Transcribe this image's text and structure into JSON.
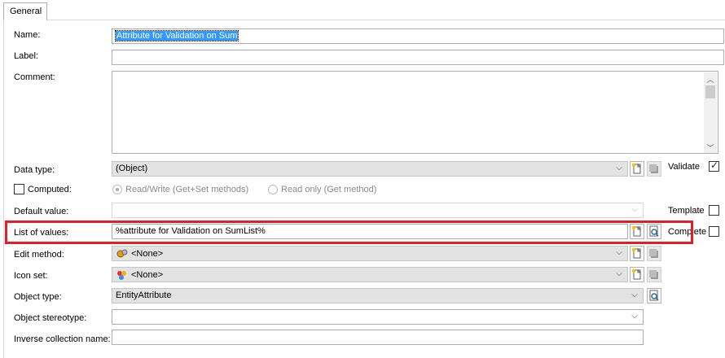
{
  "tab": {
    "label": "General"
  },
  "form": {
    "name": {
      "label": "Name:",
      "value": "Attribute for Validation on Sum"
    },
    "label_field": {
      "label": "Label:",
      "value": ""
    },
    "comment": {
      "label": "Comment:",
      "value": ""
    },
    "data_type": {
      "label": "Data type:",
      "value": "(Object)",
      "validate_label": "Validate",
      "validate_checked": true
    },
    "computed": {
      "label": "Computed:",
      "checked": false,
      "read_write_label": "Read/Write (Get+Set methods)",
      "read_only_label": "Read only (Get method)"
    },
    "default_value": {
      "label": "Default value:",
      "value": "",
      "template_label": "Template",
      "template_checked": false
    },
    "list_of_values": {
      "label": "List of values:",
      "value": "%attribute for Validation on SumList%",
      "complete_label": "Complete",
      "complete_checked": false
    },
    "edit_method": {
      "label": "Edit method:",
      "value": "<None>"
    },
    "icon_set": {
      "label": "Icon set:",
      "value": "<None>"
    },
    "object_type": {
      "label": "Object type:",
      "value": "EntityAttribute"
    },
    "object_stereotype": {
      "label": "Object stereotype:",
      "value": ""
    },
    "inverse_collection_name": {
      "label": "Inverse collection name:",
      "value": ""
    }
  },
  "icons": {
    "new": "new-item-icon",
    "properties": "properties-icon",
    "find": "find-in-list-icon",
    "edit_method": "edit-method-icon",
    "icon_set": "icon-set-icon"
  },
  "colors": {
    "highlight": "#e21f26",
    "selection": "#3399ff"
  }
}
